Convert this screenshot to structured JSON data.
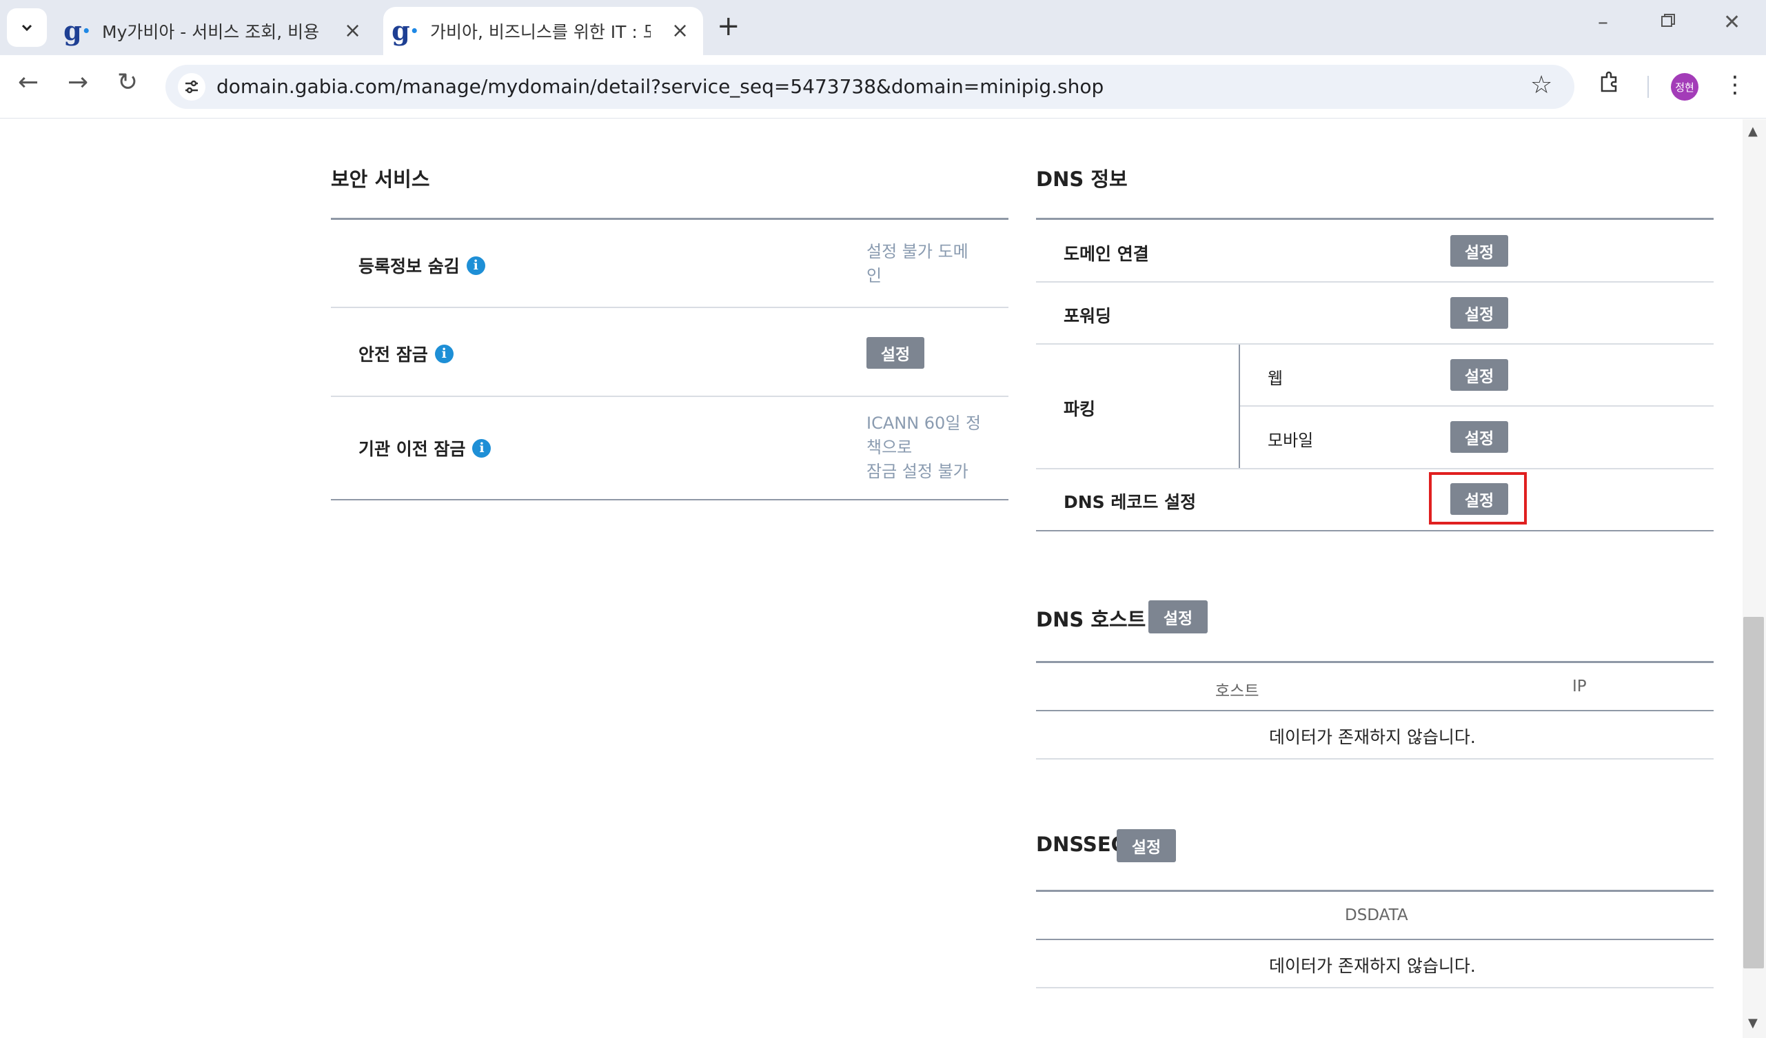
{
  "browser": {
    "tabs": [
      {
        "title": "My가비아 - 서비스 조회, 비용",
        "favicon": "gabia-logo"
      },
      {
        "title": "가비아, 비즈니스를 위한 IT : 도",
        "favicon": "gabia-logo"
      }
    ],
    "new_tab_label": "+",
    "url": "domain.gabia.com/manage/mydomain/detail?service_seq=5473738&domain=minipig.shop",
    "profile_label": "정현",
    "accent": "#a33cb8"
  },
  "security": {
    "title": "보안 서비스",
    "rows": [
      {
        "label": "등록정보 숨김",
        "value_lines": [
          "설정 불가 도메",
          "인"
        ]
      },
      {
        "label": "안전 잠금",
        "button": "설정"
      },
      {
        "label": "기관 이전 잠금",
        "value_lines": [
          "ICANN 60일 정",
          "책으로",
          "잠금 설정 불가"
        ]
      }
    ]
  },
  "dns_info": {
    "title": "DNS 정보",
    "rows": [
      {
        "label": "도메인 연결",
        "button": "설정"
      },
      {
        "label": "포워딩",
        "button": "설정"
      },
      {
        "label": "파킹",
        "sub": [
          {
            "label": "웹",
            "button": "설정"
          },
          {
            "label": "모바일",
            "button": "설정"
          }
        ]
      },
      {
        "label": "DNS 레코드 설정",
        "button": "설정",
        "highlighted": true
      }
    ]
  },
  "dns_host": {
    "title": "DNS 호스트",
    "button": "설정",
    "columns": [
      "호스트",
      "IP"
    ],
    "empty": "데이터가 존재하지 않습니다."
  },
  "dnssec": {
    "title": "DNSSEC",
    "button": "설정",
    "columns": [
      "DSDATA"
    ],
    "empty": "데이터가 존재하지 않습니다."
  },
  "colors": {
    "button": "#7d8591",
    "info_icon": "#1e8fd6",
    "highlight": "#e02020",
    "note": "#8a9bb0"
  }
}
